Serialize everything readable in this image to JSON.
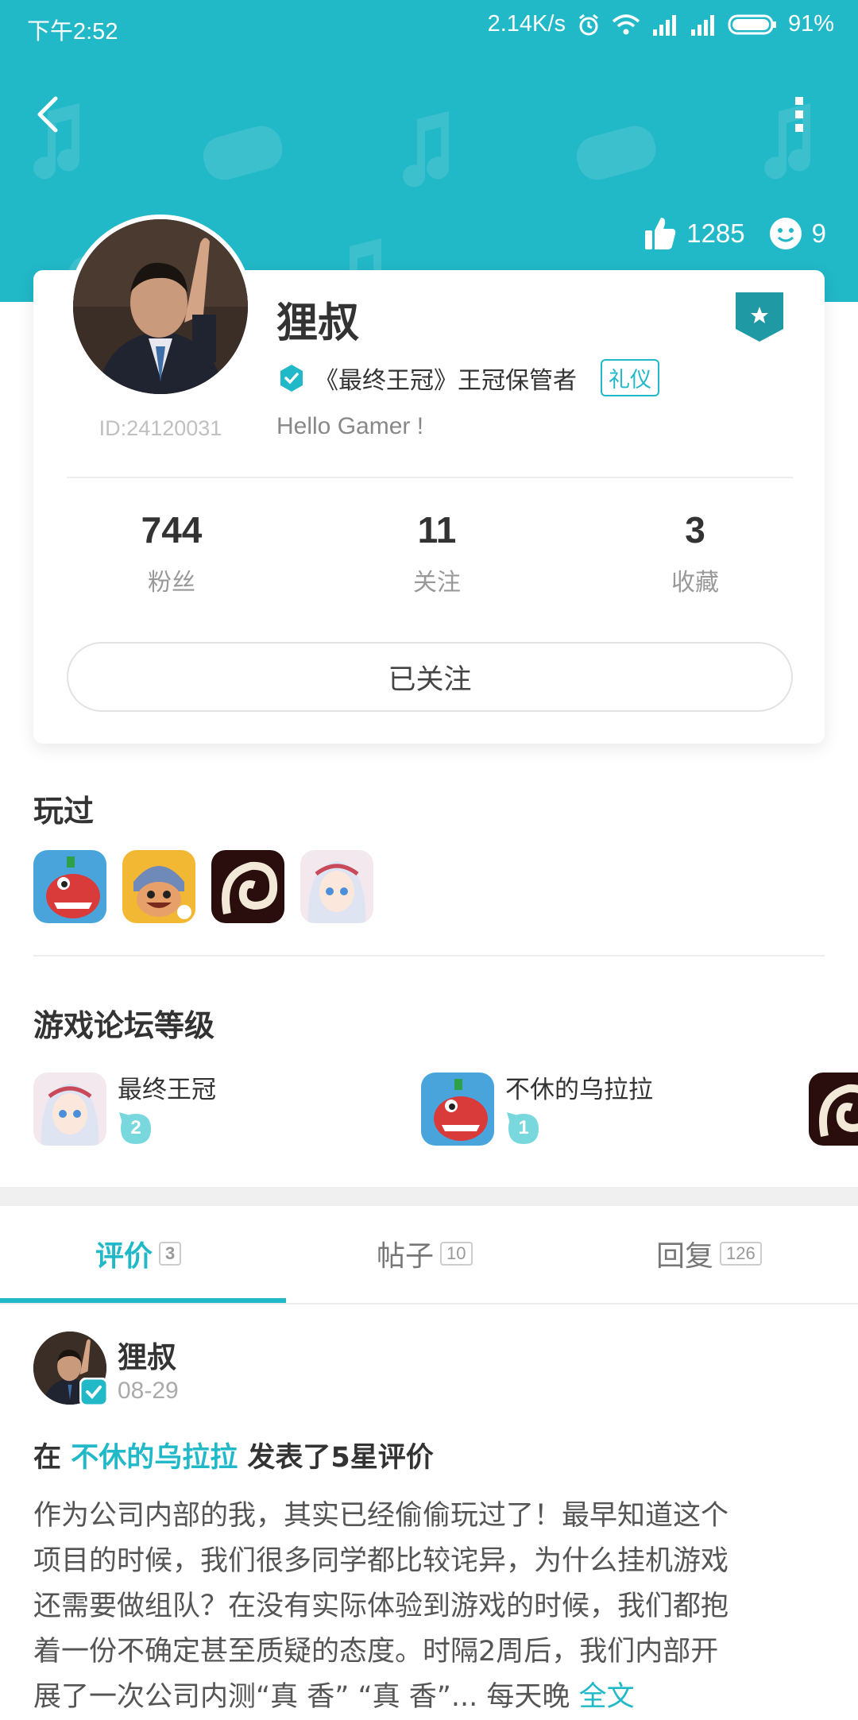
{
  "status_bar": {
    "time": "下午2:52",
    "network_speed": "2.14K/s",
    "battery": "91%"
  },
  "header": {
    "likes": "1285",
    "visitors": "9"
  },
  "profile": {
    "username": "狸叔",
    "title": "《最终王冠》王冠保管者",
    "tag": "礼仪",
    "bio": "Hello Gamer !",
    "user_id": "ID:24120031",
    "stats": [
      {
        "value": "744",
        "label": "粉丝"
      },
      {
        "value": "11",
        "label": "关注"
      },
      {
        "value": "3",
        "label": "收藏"
      }
    ],
    "follow_button": "已关注"
  },
  "played": {
    "title": "玩过",
    "games": [
      "dino-game-icon",
      "knight-game-icon",
      "dark-swirl-game-icon",
      "anime-girl-game-icon"
    ]
  },
  "forum_levels": {
    "title": "游戏论坛等级",
    "items": [
      {
        "name": "最终王冠",
        "level": "2"
      },
      {
        "name": "不休的乌拉拉",
        "level": "1"
      }
    ]
  },
  "tabs": [
    {
      "label": "评价",
      "count": "3"
    },
    {
      "label": "帖子",
      "count": "10"
    },
    {
      "label": "回复",
      "count": "126"
    }
  ],
  "post": {
    "author": "狸叔",
    "date": "08-29",
    "prefix": "在",
    "game": "不休的乌拉拉",
    "suffix": "发表了5星评价",
    "body_lines": [
      "作为公司内部的我，其实已经偷偷玩过了！最早知道这个",
      "项目的时候，我们很多同学都比较诧异，为什么挂机游戏",
      "还需要做组队？在没有实际体验到游戏的时候，我们都抱",
      "着一份不确定甚至质疑的态度。时隔2周后，我们内部开",
      "展了一次公司内测“真 香” “真 香”... 每天晚"
    ],
    "more_label": "全文"
  },
  "colors": {
    "accent": "#21b8c8"
  }
}
